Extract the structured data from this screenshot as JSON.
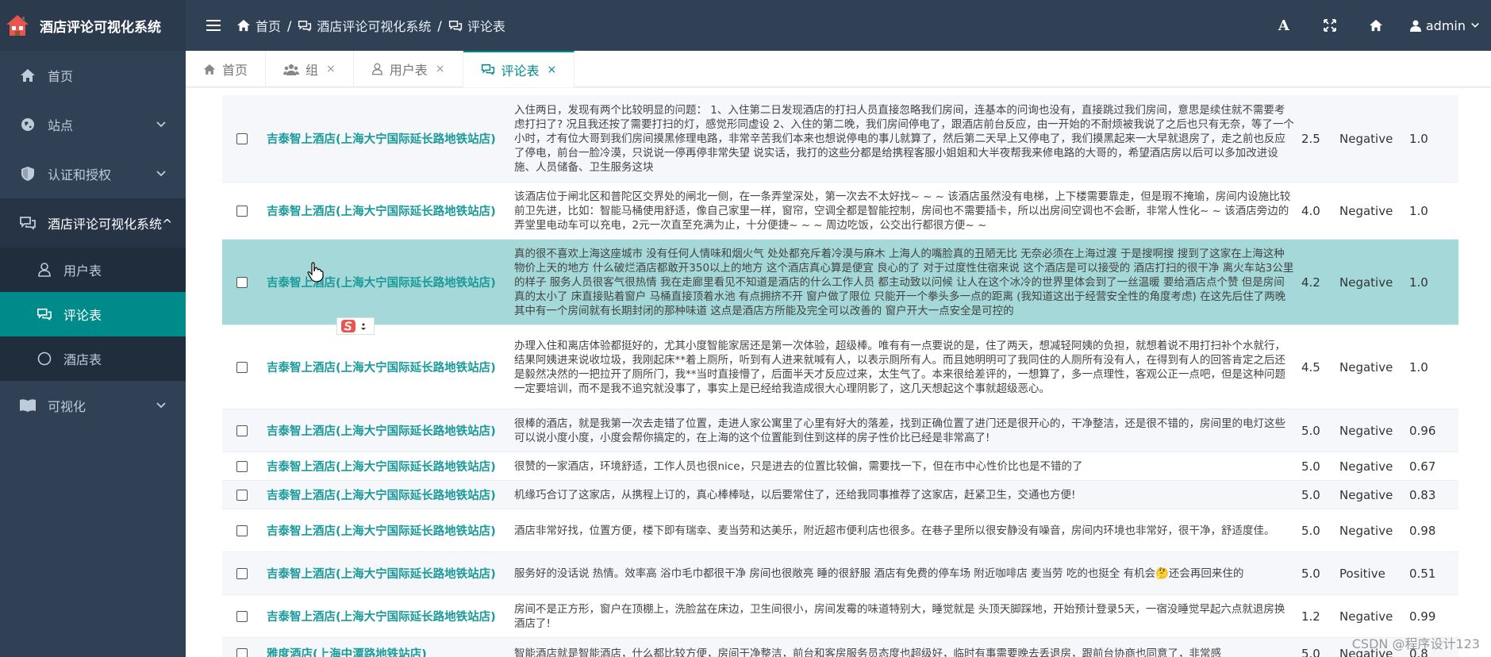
{
  "app": {
    "title": "酒店评论可视化系统",
    "icon": "hotel-house-icon"
  },
  "sidebar": {
    "items": [
      {
        "label": "首页",
        "icon": "home-icon"
      },
      {
        "label": "站点",
        "icon": "globe-icon"
      },
      {
        "label": "认证和授权",
        "icon": "shield-icon"
      },
      {
        "label": "酒店评论可视化系统^",
        "icon": "comments-icon"
      },
      {
        "label": "可视化",
        "icon": "book-icon"
      }
    ],
    "subitems": [
      {
        "label": "用户表",
        "icon": "user-icon"
      },
      {
        "label": "评论表",
        "icon": "comments-icon"
      },
      {
        "label": "酒店表",
        "icon": "circle-icon"
      }
    ]
  },
  "navbar": {
    "breadcrumbs": [
      "首页",
      "酒店评论可视化系统",
      "评论表"
    ],
    "separator": "/",
    "font_btn": "A",
    "user": "admin"
  },
  "tabs": [
    {
      "label": "首页",
      "close": ""
    },
    {
      "label": "组",
      "close": "×"
    },
    {
      "label": "用户表",
      "close": "×"
    },
    {
      "label": "评论表",
      "close": "×"
    }
  ],
  "rows": [
    {
      "hotel": "吉泰智上酒店(上海大宁国际延长路地铁站店)",
      "review": "入住两日，发现有两个比较明显的问题： 1、入住第二日发现酒店的打扫人员直接忽略我们房间，连基本的问询也没有，直接跳过我们房间，意思是续住就不需要考虑打扫了? 况且我还按了需要打扫的灯，感觉形同虚设 2、入住的第二晚，我们房间停电了，跟酒店前台反应，由一开始的不耐烦被我说了之后也只有无奈，等了一个小时，才有位大哥到我们房间摸黑修理电路，非常辛苦我们本来也想说停电的事儿就算了，然后第二天早上又停电了，我们摸黑起来一大早就退房了，走之前也反应了停电，前台一脸冷漠，只说说一停再停非常失望 说实话，我打的这些分都是给携程客服小姐姐和大半夜帮我来修电路的大哥的，希望酒店房以后可以多加改进设施、人员储备、卫生服务这块",
      "score": "2.5",
      "sentiment": "Negative",
      "prob": "1.0"
    },
    {
      "hotel": "吉泰智上酒店(上海大宁国际延长路地铁站店)",
      "review": "该酒店位于闸北区和普陀区交界处的闸北一侧，在一条弄堂深处，第一次去不太好找~ ~ ~ 该酒店虽然没有电梯，上下楼需要靠走，但是瑕不掩瑜，房间内设施比较前卫先进，比如：智能马桶使用舒适，像自己家里一样，窗帘，空调全都是智能控制，房间也不需要插卡，所以出房间空调也不会断，非常人性化~ ~ 该酒店旁边的弄堂里电动车可以充电，2元一次直至充满为止，十分便捷~ ~ ~ 周边吃饭，公交出行都很方便~ ~",
      "score": "4.0",
      "sentiment": "Negative",
      "prob": "1.0"
    },
    {
      "hotel": "吉泰智上酒店(上海大宁国际延长路地铁站店)",
      "review": "真的很不喜欢上海这座城市 没有任何人情味和烟火气 处处都充斥着冷漠与麻木 上海人的嘴脸真的丑陋无比 无奈必须在上海过渡 于是搜啊搜 搜到了这家在上海这种物价上天的地方 什么破烂酒店都敢开350以上的地方 这个酒店真心算是便宜 良心的了 对于过度性住宿来说 这个酒店是可以接受的 酒店打扫的很干净 离火车站3公里的样子 服务人员很客气很热情 我在走廊里看见不知道是酒店的什么工作人员 都主动致以问候 让人在这个冰冷的世界里体会到了一丝温暖 要给酒店点个赞 但是房间真的太小了 床直接贴着窗户 马桶直接顶着水池 有点拥挤不开 窗户做了限位 只能开一个拳头多一点的距离 (我知道这出于经营安全性的角度考虑) 在这先后住了两晚其中有一个房间就有长期封闭的那种味道 这点是酒店方所能及完全可以改善的 窗户开大一点安全是可控的",
      "score": "4.2",
      "sentiment": "Negative",
      "prob": "1.0"
    },
    {
      "hotel": "吉泰智上酒店(上海大宁国际延长路地铁站店)",
      "review": "办理入住和离店体验都挺好的，尤其小度智能家居还是第一次体验，超级棒。唯有有一点要说的是，住了两天，想减轻阿姨的负担，就想着说不用打扫补个水就行，结果阿姨进来说收垃圾，我刚起床**着上厕所，听到有人进来就喊有人，以表示厕所有人。而且她明明可了我同住的人厕所有没有人，在得到有人的回答肯定之后还是毅然决然的一把拉开了厕所门，我**当时直接懵了，后面半天才反应过来，太生气了。本来很给差评的，一想算了，多一点理性，客观公正一点吧，但是这种问题一定要培训，而不是我不追究就没事了，事实上是已经给我造成很大心理阴影了，这几天想起这个事就超级恶心。",
      "score": "4.5",
      "sentiment": "Negative",
      "prob": "1.0"
    },
    {
      "hotel": "吉泰智上酒店(上海大宁国际延长路地铁站店)",
      "review": "很棒的酒店，就是我第一次去走错了位置，走进人家公寓里了心里有好大的落差，找到正确位置了进门还是很开心的，干净整洁，还是很不错的，房间里的电灯这些可以说小度小度，小度会帮你搞定的，在上海的这个位置能到住到这样的房子性价比已经是非常高了!",
      "score": "5.0",
      "sentiment": "Negative",
      "prob": "0.96"
    },
    {
      "hotel": "吉泰智上酒店(上海大宁国际延长路地铁站店)",
      "review": "很赞的一家酒店，环境舒适，工作人员也很nice，只是进去的位置比较偏，需要找一下，但在市中心性价比也是不错的了",
      "score": "5.0",
      "sentiment": "Negative",
      "prob": "0.67"
    },
    {
      "hotel": "吉泰智上酒店(上海大宁国际延长路地铁站店)",
      "review": "机缘巧合订了这家店，从携程上订的，真心棒棒哒，以后要常住了，还给我同事推荐了这家店，赶紧卫生，交通也方便!",
      "score": "5.0",
      "sentiment": "Negative",
      "prob": "0.83"
    },
    {
      "hotel": "吉泰智上酒店(上海大宁国际延长路地铁站店)",
      "review": "酒店非常好找，位置方便，楼下即有瑞幸、麦当劳和达美乐，附近超市便利店也很多。在巷子里所以很安静没有噪音，房间内环境也非常好，很干净，舒适度佳。",
      "score": "5.0",
      "sentiment": "Negative",
      "prob": "0.98"
    },
    {
      "hotel": "吉泰智上酒店(上海大宁国际延长路地铁站店)",
      "review": "服务好的没话说 热情。效率高 浴巾毛巾都很干净 房间也很敞亮 睡的很舒服 酒店有免费的停车场 附近咖啡店 麦当劳 吃的也挺全 有机会🤔还会再回来住的",
      "score": "5.0",
      "sentiment": "Positive",
      "prob": "0.51"
    },
    {
      "hotel": "吉泰智上酒店(上海大宁国际延长路地铁站店)",
      "review": "房间不是正方形，窗户在顶棚上，洗脸盆在床边，卫生间很小，房间发霉的味道特别大，睡觉就是 头顶天脚踩地，开始预计登录5天，一宿没睡觉早起六点就退房换酒店了!",
      "score": "1.2",
      "sentiment": "Negative",
      "prob": "0.99"
    },
    {
      "hotel": "雅度酒店(上海中潭路地铁站店)",
      "review": "智能酒店就是智能酒店，什么都比较方便，房间干净整洁，前台和客房服务员态度也超级好，临时有事需要晚去丢退房，跟前台协商也同意了，非常感",
      "score": "5.0",
      "sentiment": "Negative",
      "prob": "0.8"
    }
  ],
  "watermark": "CSDN @程序设计123"
}
